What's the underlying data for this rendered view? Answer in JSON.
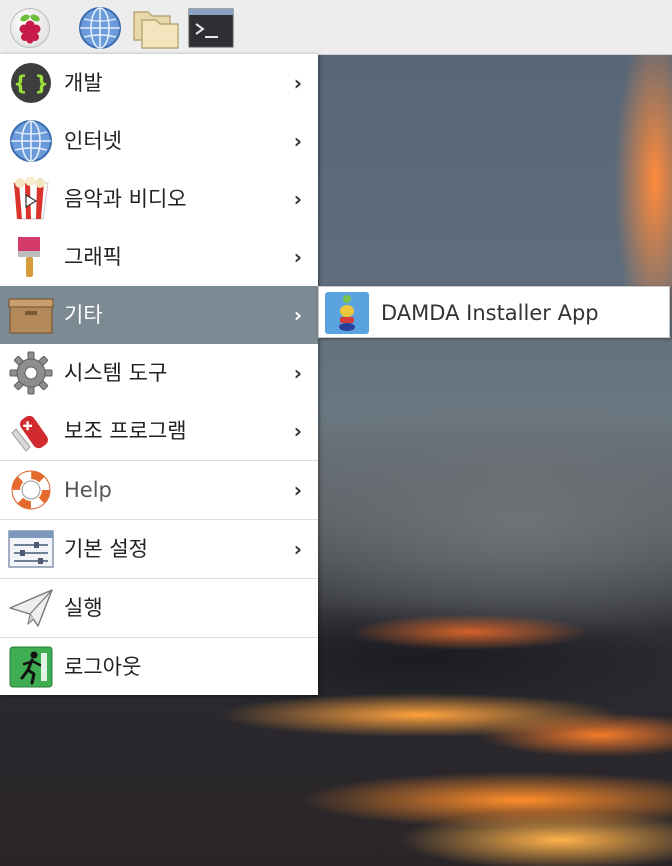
{
  "taskbar": {
    "buttons": [
      {
        "name": "raspberry-menu-icon"
      },
      {
        "name": "web-browser-icon"
      },
      {
        "name": "file-manager-icon"
      },
      {
        "name": "terminal-icon"
      }
    ]
  },
  "menu": {
    "items": [
      {
        "label": "개발",
        "icon": "code-braces-icon",
        "has_submenu": true
      },
      {
        "label": "인터넷",
        "icon": "globe-icon",
        "has_submenu": true
      },
      {
        "label": "음악과 비디오",
        "icon": "popcorn-media-icon",
        "has_submenu": true
      },
      {
        "label": "그래픽",
        "icon": "paintbrush-icon",
        "has_submenu": true
      },
      {
        "label": "기타",
        "icon": "archive-box-icon",
        "has_submenu": true,
        "active": true
      },
      {
        "label": "시스템 도구",
        "icon": "gear-icon",
        "has_submenu": true
      },
      {
        "label": "보조 프로그램",
        "icon": "swiss-knife-icon",
        "has_submenu": true
      },
      {
        "label": "Help",
        "icon": "lifebuoy-icon",
        "has_submenu": true
      },
      {
        "label": "기본 설정",
        "icon": "settings-sliders-icon",
        "has_submenu": true
      },
      {
        "label": "실행",
        "icon": "paper-plane-icon",
        "has_submenu": false
      },
      {
        "label": "로그아웃",
        "icon": "exit-running-man-icon",
        "has_submenu": false
      }
    ],
    "arrow": "›"
  },
  "submenu": {
    "items": [
      {
        "label": "DAMDA Installer App",
        "icon": "damda-app-icon"
      }
    ]
  },
  "colors": {
    "active_item": "#7c8a94",
    "taskbar": "#ededed"
  }
}
